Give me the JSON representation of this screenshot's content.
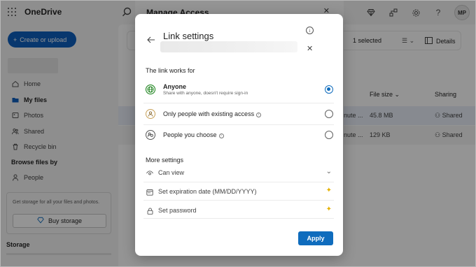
{
  "app": {
    "name": "OneDrive",
    "avatar_initials": "MP"
  },
  "sidebar": {
    "create_label": "Create or upload",
    "items": [
      {
        "label": "Home",
        "icon": "home-icon"
      },
      {
        "label": "My files",
        "icon": "folder-icon",
        "active": true
      },
      {
        "label": "Photos",
        "icon": "photos-icon"
      },
      {
        "label": "Shared",
        "icon": "shared-icon"
      },
      {
        "label": "Recycle bin",
        "icon": "recycle-bin-icon"
      }
    ],
    "browse_title": "Browse files by",
    "people_label": "People",
    "storage_promo": "Get storage for all your files and photos.",
    "buy_storage_label": "Buy storage",
    "storage_title": "Storage"
  },
  "main": {
    "selected_text": "1 selected",
    "details_label": "Details",
    "columns": {
      "file_size": "File size",
      "sharing": "Sharing"
    },
    "rows": [
      {
        "modified": "nute ...",
        "size": "45.8 MB",
        "sharing": "Shared"
      },
      {
        "modified": "nute ...",
        "size": "129 KB",
        "sharing": "Shared"
      }
    ]
  },
  "manage_access": {
    "title": "Manage Access"
  },
  "dialog": {
    "title": "Link settings",
    "section_works_for": "The link works for",
    "options": [
      {
        "title": "Anyone",
        "subtitle": "Share with anyone, doesn't require sign-in",
        "icon": "globe-icon",
        "selected": true
      },
      {
        "title": "Only people with existing access",
        "subtitle": "",
        "icon": "person-icon",
        "selected": false,
        "info": true
      },
      {
        "title": "People you choose",
        "subtitle": "",
        "icon": "people-icon",
        "selected": false,
        "info": true
      }
    ],
    "more_settings_title": "More settings",
    "settings": [
      {
        "label": "Can view",
        "icon": "eye-icon",
        "right": "chevron-down-icon"
      },
      {
        "label": "Set expiration date (MM/DD/YYYY)",
        "icon": "calendar-icon",
        "right": "sparkle-icon"
      },
      {
        "label": "Set password",
        "icon": "lock-icon",
        "right": "sparkle-icon"
      }
    ],
    "apply_label": "Apply"
  },
  "colors": {
    "accent": "#0f6cbd",
    "create_button": "#0f5fbd",
    "premium_sparkle": "#e5b100",
    "globe_green": "#107c10"
  }
}
